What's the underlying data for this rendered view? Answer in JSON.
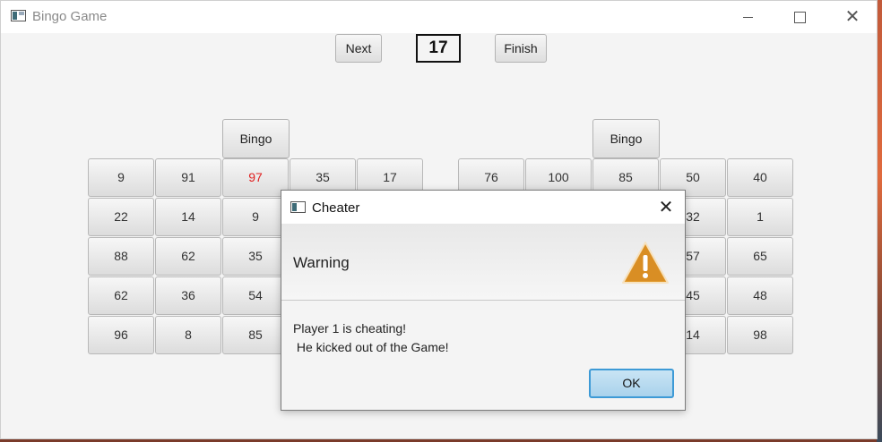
{
  "window": {
    "title": "Bingo Game"
  },
  "toolbar": {
    "next_label": "Next",
    "current_number": "17",
    "finish_label": "Finish"
  },
  "boards": [
    {
      "bingo_label": "Bingo",
      "rows": [
        [
          "9",
          "91",
          "97",
          "35",
          "17"
        ],
        [
          "22",
          "14",
          "9"
        ],
        [
          "88",
          "62",
          "35"
        ],
        [
          "62",
          "36",
          "54"
        ],
        [
          "96",
          "8",
          "85"
        ]
      ]
    },
    {
      "bingo_label": "Bingo",
      "rows": [
        [
          "76",
          "100",
          "85",
          "50",
          "40"
        ],
        [
          "32",
          "1"
        ],
        [
          "57",
          "65"
        ],
        [
          "45",
          "48"
        ],
        [
          "14",
          "98"
        ]
      ]
    }
  ],
  "dialog": {
    "title": "Cheater",
    "close_glyph": "✕",
    "heading": "Warning",
    "message": "Player 1 is cheating!\n He kicked out of the Game!",
    "ok_label": "OK"
  },
  "colors": {
    "marked": "#e02020",
    "warning": "#e29a2c",
    "ok_border": "#3d9ad6"
  }
}
